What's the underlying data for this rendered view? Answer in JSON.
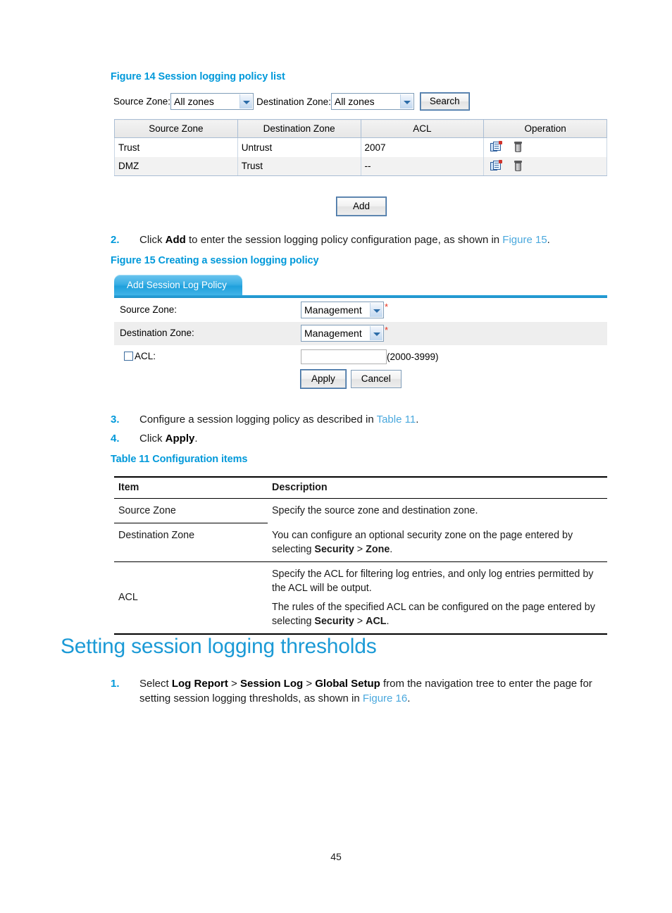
{
  "figure14": {
    "caption": "Figure 14 Session logging policy list",
    "search": {
      "source_zone_label": "Source Zone:",
      "source_zone_value": "All zones",
      "destination_zone_label": "Destination Zone:",
      "destination_zone_value": "All zones",
      "search_button": "Search"
    },
    "table": {
      "headers": [
        "Source Zone",
        "Destination Zone",
        "ACL",
        "Operation"
      ],
      "rows": [
        {
          "source_zone": "Trust",
          "destination_zone": "Untrust",
          "acl": "2007"
        },
        {
          "source_zone": "DMZ",
          "destination_zone": "Trust",
          "acl": "--"
        }
      ]
    },
    "add_button": "Add"
  },
  "step2": {
    "number": "2.",
    "text_1": "Click ",
    "bold_1": "Add",
    "text_2": " to enter the session logging policy configuration page, as shown in ",
    "link": "Figure 15",
    "text_3": "."
  },
  "figure15": {
    "caption": "Figure 15 Creating a session logging policy",
    "tab_title": "Add Session Log Policy",
    "rows": [
      {
        "label": "Source Zone:",
        "value": "Management",
        "required": "*"
      },
      {
        "label": "Destination Zone:",
        "value": "Management",
        "required": "*"
      }
    ],
    "acl_label": "ACL:",
    "acl_value": "",
    "acl_hint": "(2000-3999)",
    "apply_button": "Apply",
    "cancel_button": "Cancel"
  },
  "step3": {
    "number": "3.",
    "text_1": "Configure a session logging policy as described in ",
    "link": "Table 11",
    "text_2": "."
  },
  "step4": {
    "number": "4.",
    "text_1": "Click ",
    "bold_1": "Apply",
    "text_2": "."
  },
  "table11": {
    "caption": "Table 11 Configuration items",
    "headers": [
      "Item",
      "Description"
    ],
    "rows": [
      {
        "item": "Source Zone",
        "desc_lines": [
          {
            "plain_1": "Specify the source zone and destination zone.",
            "bold": "",
            "plain_2": ""
          }
        ]
      },
      {
        "item": "Destination Zone",
        "desc_lines": [
          {
            "plain_1": "You can configure an optional security zone on the page entered by selecting ",
            "bold": "Security",
            "sep": " > ",
            "bold2": "Zone",
            "plain_2": "."
          }
        ]
      },
      {
        "item": "ACL",
        "desc_lines": [
          {
            "plain_1": "Specify the ACL for filtering log entries, and only log entries permitted by the ACL will be output.",
            "bold": "",
            "plain_2": ""
          },
          {
            "plain_1": "The rules of the specified ACL can be configured on the page entered by selecting ",
            "bold": "Security",
            "sep": " > ",
            "bold2": "ACL",
            "plain_2": "."
          }
        ]
      }
    ]
  },
  "section": {
    "title": "Setting session logging thresholds"
  },
  "step1b": {
    "number": "1.",
    "text_1": "Select ",
    "bold_1": "Log Report",
    "sep_1": " > ",
    "bold_2": "Session Log",
    "sep_2": " > ",
    "bold_3": "Global Setup",
    "text_2": " from the navigation tree to enter the page for setting session logging thresholds, as shown in ",
    "link": "Figure 16",
    "text_3": "."
  },
  "footer": {
    "page_number": "45"
  },
  "colors": {
    "accent": "#0099da",
    "heading": "#1b9ad6",
    "link": "#4aa8dd",
    "required": "#e8321e"
  }
}
